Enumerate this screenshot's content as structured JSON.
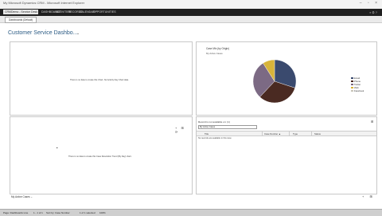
{
  "window": {
    "title": "My Microsoft Dynamics CRM - Microsoft Internet Explorer",
    "controls": "– ▫ ×"
  },
  "nav": {
    "app": "CRMDemo - Service Desk",
    "items": [
      "DASHBOARDS",
      "ACTIVITIES",
      "RECORDS",
      "CALENDAR",
      "OPPORTUNITIES"
    ],
    "right_icons": "⌕ ⚙ ?"
  },
  "cmdbar": {
    "tab_label": "Dashboards (Default)"
  },
  "dashboard": {
    "title": "Customer Service Dashbo...",
    "chevron": "⌄"
  },
  "top_left_pane": {
    "message": "There is no data to create this Chart. No Activity Day Chart data."
  },
  "chart_pane": {
    "title": "Case Mix (by Origin)",
    "subtitle": "My Active Cases"
  },
  "chart_data": {
    "type": "pie",
    "categories": [
      "Email",
      "Phone",
      "Twitter",
      "Web",
      "Facebook"
    ],
    "values": [
      30,
      32,
      29,
      9,
      0
    ],
    "colors": [
      "#3a4a6e",
      "#4a2a22",
      "#7c6a84",
      "#d8b43a",
      "#c8c4b8"
    ]
  },
  "bottom_left_pane": {
    "message": "There is no data to create this Case Resolution Trend (By Day) chart.",
    "icons": "+ ⊞ ⟳"
  },
  "list_pane": {
    "label": "Record is not available on: (1)",
    "view_select": "My Active Cases",
    "columns": [
      "Title",
      "Case Number ▲",
      "Type",
      "Status"
    ],
    "empty": "No records are available in this view."
  },
  "footer": {
    "left_label": "My Active Cases",
    "left_chevron": "⌄",
    "right_icons": "+ ⊞"
  },
  "status": {
    "segments": [
      "Page: Dashboards Line   ",
      "1 - 1 of 1",
      "   Sort by: Case Number   ",
      "1 of 1 selected   ",
      "100%"
    ]
  }
}
